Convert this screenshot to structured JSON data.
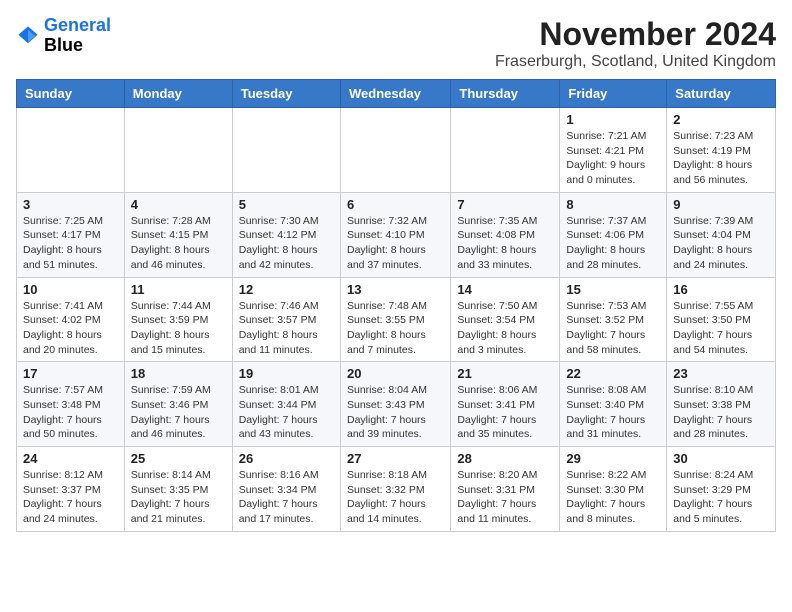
{
  "header": {
    "logo_line1": "General",
    "logo_line2": "Blue",
    "month_year": "November 2024",
    "location": "Fraserburgh, Scotland, United Kingdom"
  },
  "weekdays": [
    "Sunday",
    "Monday",
    "Tuesday",
    "Wednesday",
    "Thursday",
    "Friday",
    "Saturday"
  ],
  "weeks": [
    [
      {
        "day": "",
        "info": ""
      },
      {
        "day": "",
        "info": ""
      },
      {
        "day": "",
        "info": ""
      },
      {
        "day": "",
        "info": ""
      },
      {
        "day": "",
        "info": ""
      },
      {
        "day": "1",
        "info": "Sunrise: 7:21 AM\nSunset: 4:21 PM\nDaylight: 9 hours and 0 minutes."
      },
      {
        "day": "2",
        "info": "Sunrise: 7:23 AM\nSunset: 4:19 PM\nDaylight: 8 hours and 56 minutes."
      }
    ],
    [
      {
        "day": "3",
        "info": "Sunrise: 7:25 AM\nSunset: 4:17 PM\nDaylight: 8 hours and 51 minutes."
      },
      {
        "day": "4",
        "info": "Sunrise: 7:28 AM\nSunset: 4:15 PM\nDaylight: 8 hours and 46 minutes."
      },
      {
        "day": "5",
        "info": "Sunrise: 7:30 AM\nSunset: 4:12 PM\nDaylight: 8 hours and 42 minutes."
      },
      {
        "day": "6",
        "info": "Sunrise: 7:32 AM\nSunset: 4:10 PM\nDaylight: 8 hours and 37 minutes."
      },
      {
        "day": "7",
        "info": "Sunrise: 7:35 AM\nSunset: 4:08 PM\nDaylight: 8 hours and 33 minutes."
      },
      {
        "day": "8",
        "info": "Sunrise: 7:37 AM\nSunset: 4:06 PM\nDaylight: 8 hours and 28 minutes."
      },
      {
        "day": "9",
        "info": "Sunrise: 7:39 AM\nSunset: 4:04 PM\nDaylight: 8 hours and 24 minutes."
      }
    ],
    [
      {
        "day": "10",
        "info": "Sunrise: 7:41 AM\nSunset: 4:02 PM\nDaylight: 8 hours and 20 minutes."
      },
      {
        "day": "11",
        "info": "Sunrise: 7:44 AM\nSunset: 3:59 PM\nDaylight: 8 hours and 15 minutes."
      },
      {
        "day": "12",
        "info": "Sunrise: 7:46 AM\nSunset: 3:57 PM\nDaylight: 8 hours and 11 minutes."
      },
      {
        "day": "13",
        "info": "Sunrise: 7:48 AM\nSunset: 3:55 PM\nDaylight: 8 hours and 7 minutes."
      },
      {
        "day": "14",
        "info": "Sunrise: 7:50 AM\nSunset: 3:54 PM\nDaylight: 8 hours and 3 minutes."
      },
      {
        "day": "15",
        "info": "Sunrise: 7:53 AM\nSunset: 3:52 PM\nDaylight: 7 hours and 58 minutes."
      },
      {
        "day": "16",
        "info": "Sunrise: 7:55 AM\nSunset: 3:50 PM\nDaylight: 7 hours and 54 minutes."
      }
    ],
    [
      {
        "day": "17",
        "info": "Sunrise: 7:57 AM\nSunset: 3:48 PM\nDaylight: 7 hours and 50 minutes."
      },
      {
        "day": "18",
        "info": "Sunrise: 7:59 AM\nSunset: 3:46 PM\nDaylight: 7 hours and 46 minutes."
      },
      {
        "day": "19",
        "info": "Sunrise: 8:01 AM\nSunset: 3:44 PM\nDaylight: 7 hours and 43 minutes."
      },
      {
        "day": "20",
        "info": "Sunrise: 8:04 AM\nSunset: 3:43 PM\nDaylight: 7 hours and 39 minutes."
      },
      {
        "day": "21",
        "info": "Sunrise: 8:06 AM\nSunset: 3:41 PM\nDaylight: 7 hours and 35 minutes."
      },
      {
        "day": "22",
        "info": "Sunrise: 8:08 AM\nSunset: 3:40 PM\nDaylight: 7 hours and 31 minutes."
      },
      {
        "day": "23",
        "info": "Sunrise: 8:10 AM\nSunset: 3:38 PM\nDaylight: 7 hours and 28 minutes."
      }
    ],
    [
      {
        "day": "24",
        "info": "Sunrise: 8:12 AM\nSunset: 3:37 PM\nDaylight: 7 hours and 24 minutes."
      },
      {
        "day": "25",
        "info": "Sunrise: 8:14 AM\nSunset: 3:35 PM\nDaylight: 7 hours and 21 minutes."
      },
      {
        "day": "26",
        "info": "Sunrise: 8:16 AM\nSunset: 3:34 PM\nDaylight: 7 hours and 17 minutes."
      },
      {
        "day": "27",
        "info": "Sunrise: 8:18 AM\nSunset: 3:32 PM\nDaylight: 7 hours and 14 minutes."
      },
      {
        "day": "28",
        "info": "Sunrise: 8:20 AM\nSunset: 3:31 PM\nDaylight: 7 hours and 11 minutes."
      },
      {
        "day": "29",
        "info": "Sunrise: 8:22 AM\nSunset: 3:30 PM\nDaylight: 7 hours and 8 minutes."
      },
      {
        "day": "30",
        "info": "Sunrise: 8:24 AM\nSunset: 3:29 PM\nDaylight: 7 hours and 5 minutes."
      }
    ]
  ]
}
